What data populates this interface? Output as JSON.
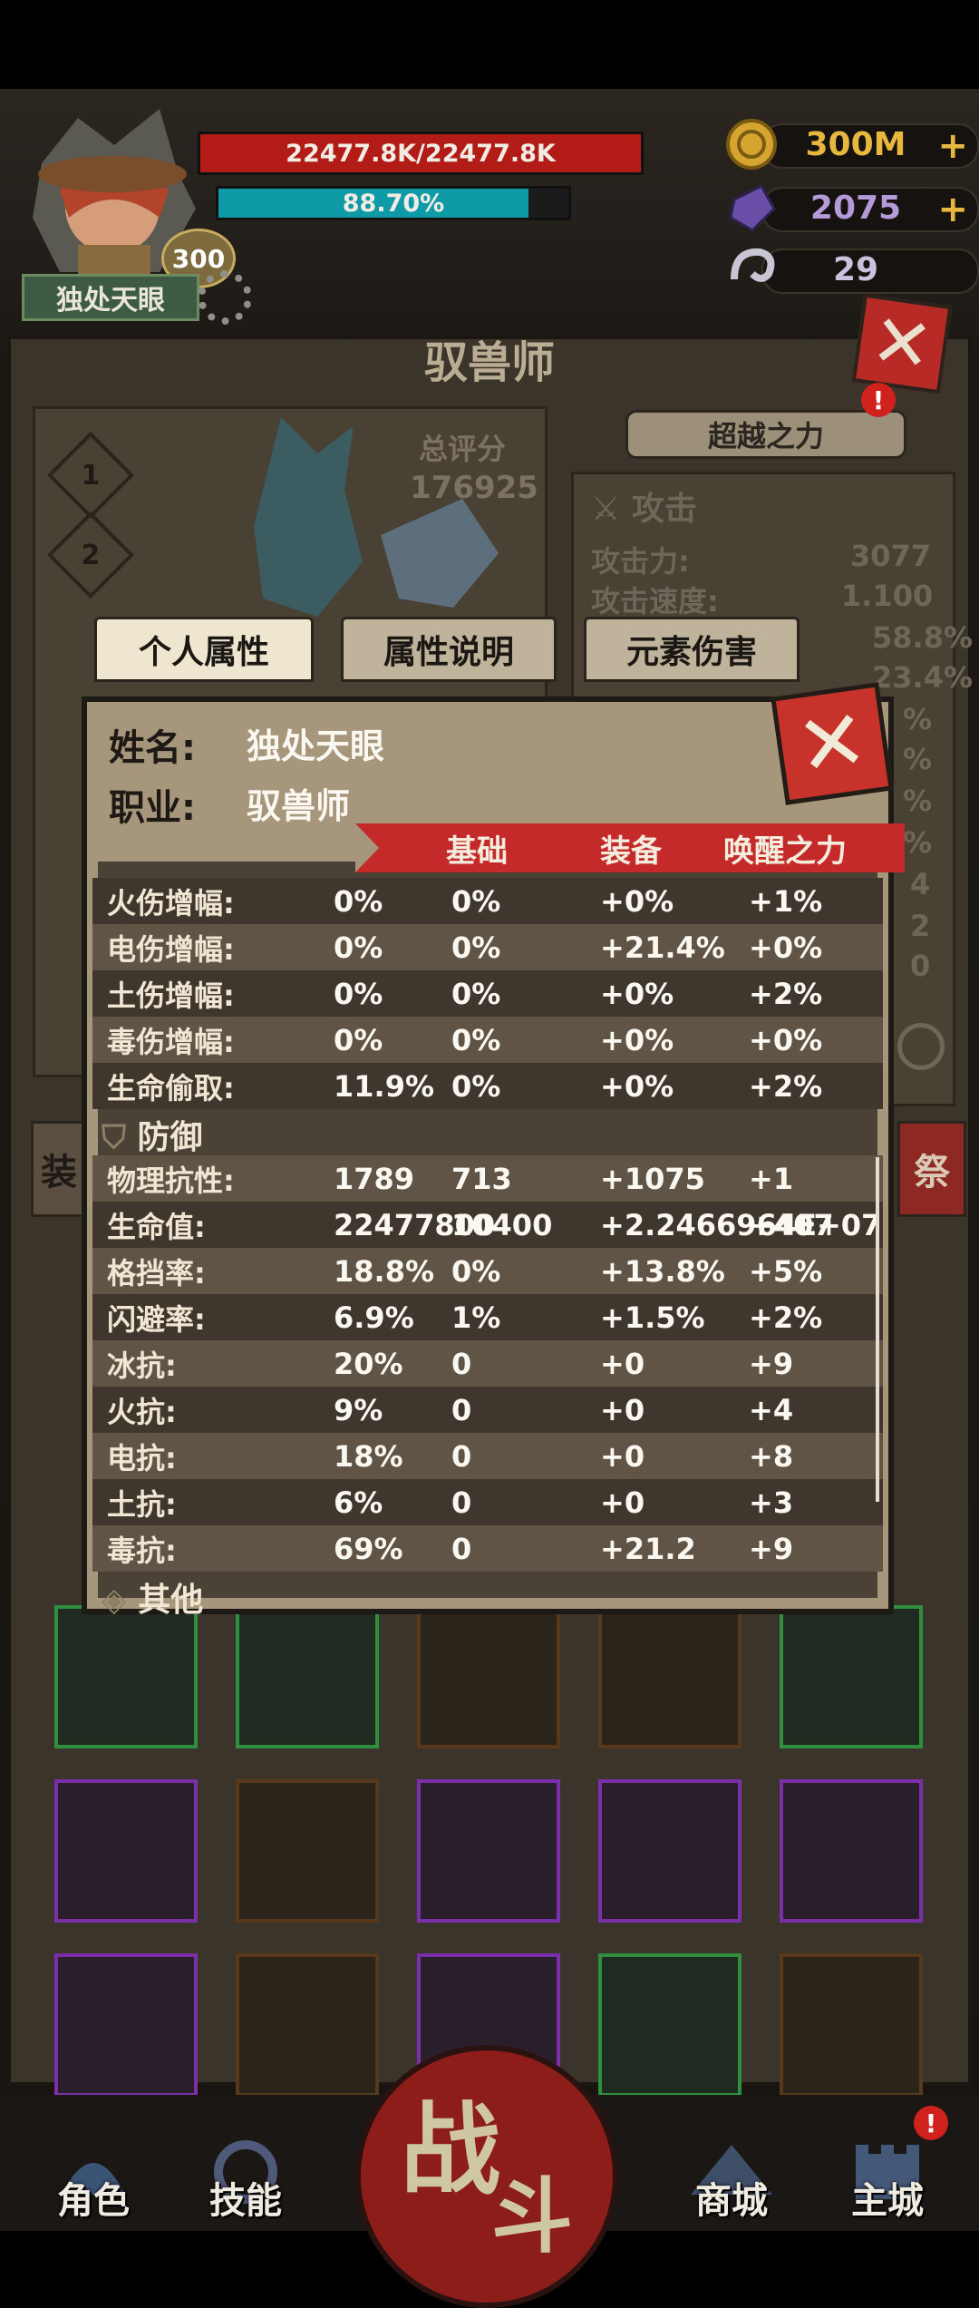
{
  "player": {
    "name": "独处天眼",
    "level": "300",
    "hp_text": "22477.8K/22477.8K",
    "exp_text": "88.70%",
    "exp_fraction": 0.887
  },
  "resources": {
    "gold": "300M",
    "crystal": "2075",
    "horn": "29"
  },
  "panel": {
    "title": "驭兽师",
    "surpass_button": "超越之力",
    "score_label": "总评分",
    "score_value": "176925",
    "slot1": "1",
    "slot2": "2",
    "attack_header": "攻击",
    "attack_stats": [
      {
        "label": "攻击力:",
        "value": "3077"
      },
      {
        "label": "攻击速度:",
        "value": "1.100"
      },
      {
        "label": "",
        "value": "58.8%"
      },
      {
        "label": "",
        "value": "23.4%"
      }
    ],
    "side_partial_values": [
      "%",
      "%",
      "%",
      "%",
      "4",
      "2",
      "0"
    ]
  },
  "tabs": [
    "个人属性",
    "属性说明",
    "元素伤害"
  ],
  "modal": {
    "name_label": "姓名:",
    "name_value": "独处天眼",
    "job_label": "职业:",
    "job_value": "驭兽师",
    "columns": [
      "基础",
      "装备",
      "唤醒之力"
    ],
    "rows_a": [
      {
        "label": "火伤增幅:",
        "v1": "0%",
        "v2": "0%",
        "v3": "+0%",
        "v4": "+1%"
      },
      {
        "label": "电伤增幅:",
        "v1": "0%",
        "v2": "0%",
        "v3": "+21.4%",
        "v4": "+0%"
      },
      {
        "label": "土伤增幅:",
        "v1": "0%",
        "v2": "0%",
        "v3": "+0%",
        "v4": "+2%"
      },
      {
        "label": "毒伤增幅:",
        "v1": "0%",
        "v2": "0%",
        "v3": "+0%",
        "v4": "+0%"
      },
      {
        "label": "生命偷取:",
        "v1": "11.9%",
        "v2": "0%",
        "v3": "+0%",
        "v4": "+2%"
      }
    ],
    "defense_header": "防御",
    "rows_b": [
      {
        "label": "物理抗性:",
        "v1": "1789",
        "v2": "713",
        "v3": "+1075",
        "v4": "+1"
      },
      {
        "label": "生命值:",
        "v1": "22477800",
        "v2": "10400",
        "v3": "+2.2466964E+07",
        "v4": "+407"
      },
      {
        "label": "格挡率:",
        "v1": "18.8%",
        "v2": "0%",
        "v3": "+13.8%",
        "v4": "+5%"
      },
      {
        "label": "闪避率:",
        "v1": "6.9%",
        "v2": "1%",
        "v3": "+1.5%",
        "v4": "+2%"
      },
      {
        "label": "冰抗:",
        "v1": "20%",
        "v2": "0",
        "v3": "+0",
        "v4": "+9"
      },
      {
        "label": "火抗:",
        "v1": "9%",
        "v2": "0",
        "v3": "+0",
        "v4": "+4"
      },
      {
        "label": "电抗:",
        "v1": "18%",
        "v2": "0",
        "v3": "+0",
        "v4": "+8"
      },
      {
        "label": "土抗:",
        "v1": "6%",
        "v2": "0",
        "v3": "+0",
        "v4": "+3"
      },
      {
        "label": "毒抗:",
        "v1": "69%",
        "v2": "0",
        "v3": "+21.2",
        "v4": "+9"
      }
    ],
    "other_header": "其他"
  },
  "side_buttons": {
    "left": "装",
    "right": "祭"
  },
  "nav": {
    "role": "角色",
    "skill": "技能",
    "battle_1": "战",
    "battle_2": "斗",
    "shop": "商城",
    "city": "主城"
  },
  "colors": {
    "hp": "#b31b16",
    "exp": "#0f9aa8",
    "accent_red": "#c32a29",
    "gold_text": "#e8b73e",
    "crystal_text": "#b49ad8",
    "horn_text": "#c8c2df"
  }
}
